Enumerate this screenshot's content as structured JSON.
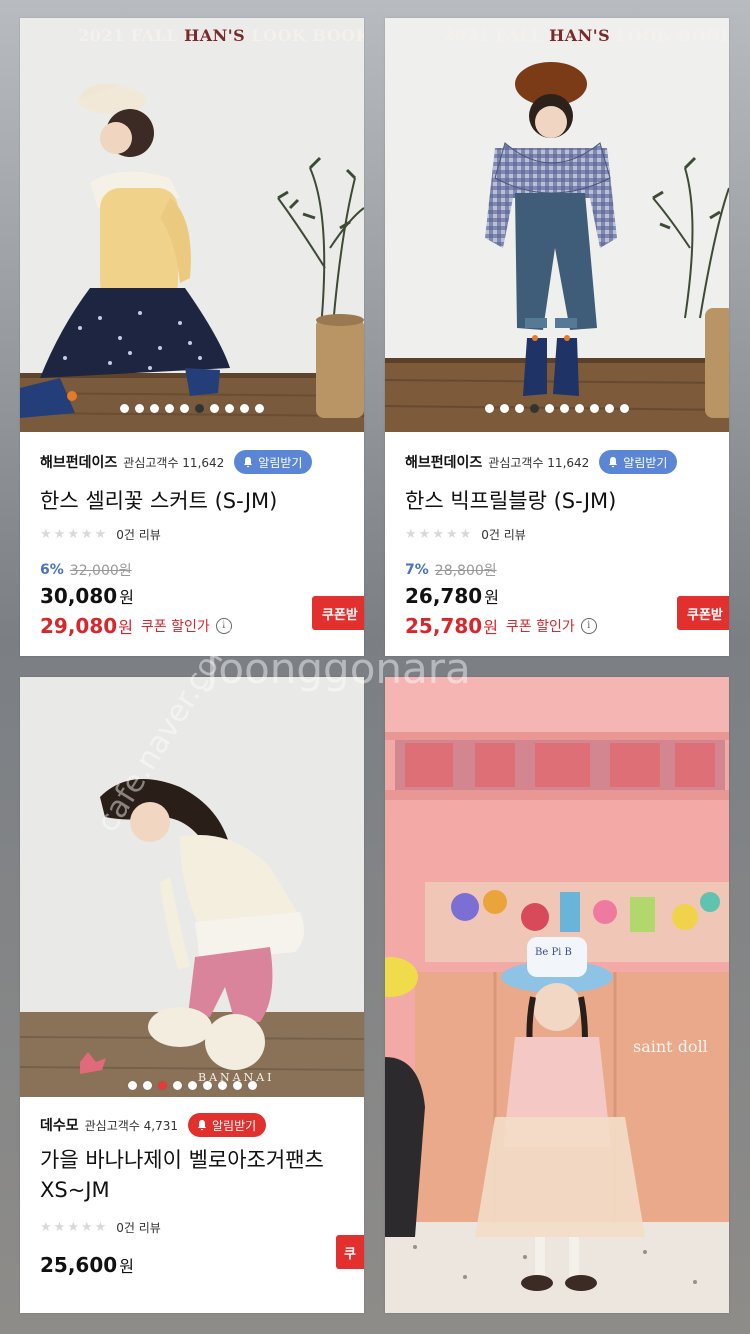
{
  "watermarks": {
    "main": "Joonggonara",
    "cafe": "cafe.naver.com/joonggonara",
    "korean": "해브펀데이즈"
  },
  "colors": {
    "alarm_blue": "#5b86d6",
    "alarm_red": "#e2302f",
    "coupon_red": "#d9262b",
    "discount_blue": "#4a72c0"
  },
  "cards": [
    {
      "lookbook": {
        "pre": "2021 FALL ",
        "brand": "HAN'S",
        "post": " LOOK BOOK"
      },
      "carousel": {
        "count": 10,
        "active": 6
      },
      "seller": "해브펀데이즈",
      "interest": "관심고객수 11,642",
      "alarm": "알림받기",
      "title": "한스 셀리꽃 스커트 (S-JM)",
      "review": "0건 리뷰",
      "discount_pct": "6%",
      "original_price": "32,000원",
      "price": "30,080",
      "price_unit": "원",
      "coupon_price": "29,080",
      "coupon_unit": "원",
      "coupon_label": "쿠폰 할인가",
      "coupon_button": "쿠폰받"
    },
    {
      "lookbook": {
        "pre": "2021 FALL ",
        "brand": "HAN'S",
        "post": " LOOK BOOK"
      },
      "carousel": {
        "count": 10,
        "active": 4
      },
      "seller": "해브펀데이즈",
      "interest": "관심고객수 11,642",
      "alarm": "알림받기",
      "title": "한스 빅프릴블랑 (S-JM)",
      "review": "0건 리뷰",
      "discount_pct": "7%",
      "original_price": "28,800원",
      "price": "26,780",
      "price_unit": "원",
      "coupon_price": "25,780",
      "coupon_unit": "원",
      "coupon_label": "쿠폰 할인가",
      "coupon_button": "쿠폰받"
    },
    {
      "photo_text": "BANANAI",
      "carousel": {
        "count": 9,
        "active": 3
      },
      "seller": "데수모",
      "interest": "관심고객수 4,731",
      "alarm": "알림받기",
      "title_line1": "가을 바나나제이 벨로아조거팬츠",
      "title_line2": "XS~JM",
      "review": "0건 리뷰",
      "price": "25,600",
      "price_unit": "원",
      "coupon_button": "쿠"
    },
    {
      "shop_sign": "saint doll",
      "hat_text": "Be Pi B"
    }
  ]
}
